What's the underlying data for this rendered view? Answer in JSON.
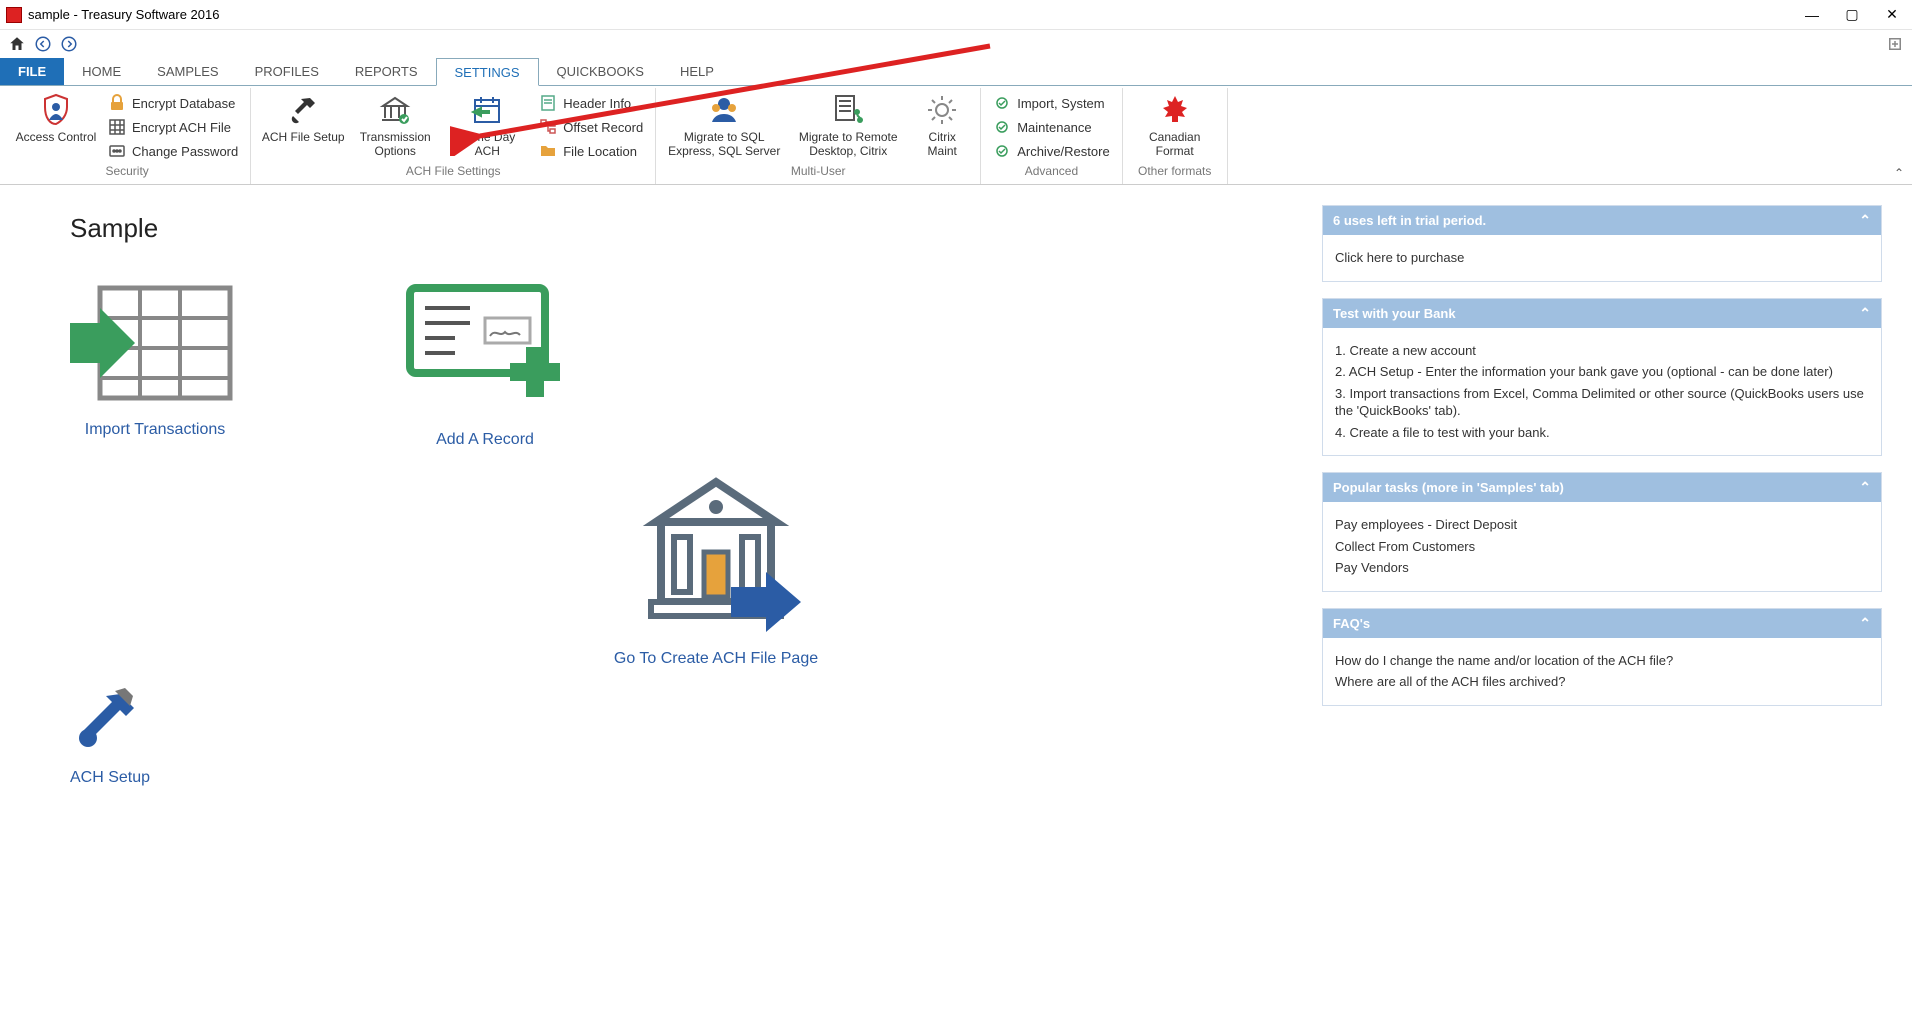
{
  "window": {
    "title": "sample - Treasury Software 2016"
  },
  "tabs": {
    "file": "FILE",
    "items": [
      "HOME",
      "SAMPLES",
      "PROFILES",
      "REPORTS",
      "SETTINGS",
      "QUICKBOOKS",
      "HELP"
    ],
    "active_index": 4
  },
  "ribbon": {
    "security": {
      "label": "Security",
      "access_control": "Access Control",
      "encrypt_db": "Encrypt Database",
      "encrypt_ach": "Encrypt ACH File",
      "change_pw": "Change Password"
    },
    "achfile": {
      "label": "ACH File Settings",
      "ach_setup": "ACH File Setup",
      "transmission": "Transmission Options",
      "same_day": "Same Day ACH",
      "header_info": "Header Info",
      "offset_record": "Offset Record",
      "file_location": "File Location"
    },
    "multiuser": {
      "label": "Multi-User",
      "migrate_sql": "Migrate to SQL Express, SQL Server",
      "migrate_remote": "Migrate to Remote Desktop, Citrix",
      "citrix_maint": "Citrix Maint"
    },
    "advanced": {
      "label": "Advanced",
      "import_system": "Import, System",
      "maintenance": "Maintenance",
      "archive_restore": "Archive/Restore"
    },
    "other": {
      "label": "Other formats",
      "canadian": "Canadian Format"
    }
  },
  "page": {
    "title": "Sample",
    "tiles": {
      "import": "Import Transactions",
      "add_record": "Add A Record",
      "create_ach": "Go To Create ACH File Page",
      "ach_setup": "ACH Setup"
    }
  },
  "panels": {
    "trial": {
      "title": "6 uses left in trial period.",
      "link": "Click here to purchase"
    },
    "test": {
      "title": "Test with your Bank",
      "s1": "1. Create a new account",
      "s2": "2. ACH Setup - Enter the information your bank gave you (optional - can be done later)",
      "s3": "3. Import transactions from Excel, Comma Delimited or other source (QuickBooks users use the 'QuickBooks' tab).",
      "s4": "4. Create a file to test with your bank."
    },
    "popular": {
      "title": "Popular tasks (more in 'Samples' tab)",
      "p1": "Pay employees - Direct Deposit",
      "p2": "Collect From Customers",
      "p3": "Pay Vendors"
    },
    "faq": {
      "title": "FAQ's",
      "f1": "How do I change the name and/or location of the ACH file?",
      "f2": "Where are all of the ACH files archived?"
    }
  }
}
